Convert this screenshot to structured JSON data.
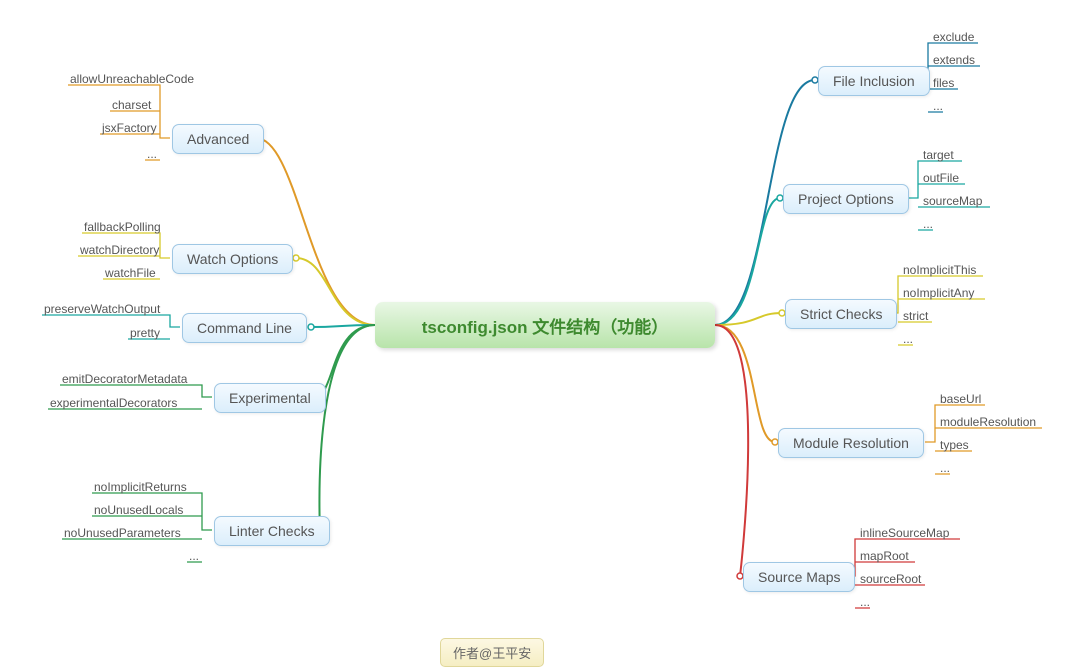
{
  "center": {
    "title": "tsconfig.json 文件结构（功能）"
  },
  "author": "作者@王平安",
  "branches": {
    "advanced": {
      "label": "Advanced",
      "leaves": [
        "allowUnreachableCode",
        "charset",
        "jsxFactory",
        "..."
      ]
    },
    "watchOptions": {
      "label": "Watch Options",
      "leaves": [
        "fallbackPolling",
        "watchDirectory",
        "watchFile"
      ]
    },
    "commandLine": {
      "label": "Command Line",
      "leaves": [
        "preserveWatchOutput",
        "pretty"
      ]
    },
    "experimental": {
      "label": "Experimental",
      "leaves": [
        "emitDecoratorMetadata",
        "experimentalDecorators"
      ]
    },
    "linterChecks": {
      "label": "Linter Checks",
      "leaves": [
        "noImplicitReturns",
        "noUnusedLocals",
        "noUnusedParameters",
        "..."
      ]
    },
    "fileInclusion": {
      "label": "File Inclusion",
      "leaves": [
        "exclude",
        "extends",
        "files",
        "..."
      ]
    },
    "projectOptions": {
      "label": "Project Options",
      "leaves": [
        "target",
        "outFile",
        "sourceMap",
        "..."
      ]
    },
    "strictChecks": {
      "label": "Strict Checks",
      "leaves": [
        "noImplicitThis",
        "noImplicitAny",
        "strict",
        "..."
      ]
    },
    "moduleRes": {
      "label": "Module Resolution",
      "leaves": [
        "baseUrl",
        "moduleResolution",
        "types",
        "..."
      ]
    },
    "sourceMaps": {
      "label": "Source Maps",
      "leaves": [
        "inlineSourceMap",
        "mapRoot",
        "sourceRoot",
        "..."
      ]
    }
  },
  "colors": {
    "advanced": "#e09a28",
    "watchOptions": "#d6c92b",
    "commandLine": "#1aa7a0",
    "experimental": "#2f9b4e",
    "linterChecks": "#2f9b4e",
    "fileInclusion": "#1a7aa0",
    "projectOptions": "#1aa7a0",
    "strictChecks": "#d6c92b",
    "moduleRes": "#e09a28",
    "sourceMaps": "#d03a3a"
  }
}
